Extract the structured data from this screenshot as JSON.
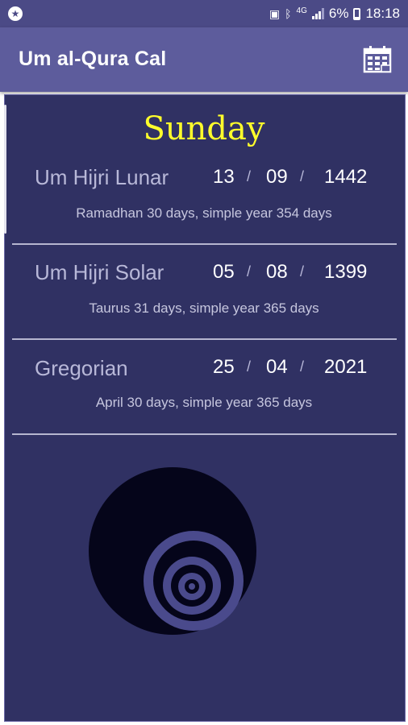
{
  "status_bar": {
    "network": "4G",
    "battery": "6%",
    "time": "18:18"
  },
  "app_bar": {
    "title": "Um al-Qura Cal",
    "calendar_icon": "calendar-grid-icon"
  },
  "day": "Sunday",
  "calendars": [
    {
      "name": "Um Hijri Lunar",
      "day": "13",
      "month": "09",
      "year": "1442",
      "sep1": "/",
      "sep2": "/",
      "description": "Ramadhan 30 days, simple year 354 days"
    },
    {
      "name": "Um Hijri Solar",
      "day": "05",
      "month": "08",
      "year": "1399",
      "sep1": "/",
      "sep2": "/",
      "description": "Taurus 31 days, simple year 365 days"
    },
    {
      "name": "Gregorian",
      "day": "25",
      "month": "04",
      "year": "2021",
      "sep1": "/",
      "sep2": "/",
      "description": "April 30 days, simple year 365 days"
    }
  ],
  "colors": {
    "status_bar": "#4b4a86",
    "app_bar": "#5d5c9c",
    "card_bg": "#303163",
    "day_title": "#ffff2b"
  }
}
